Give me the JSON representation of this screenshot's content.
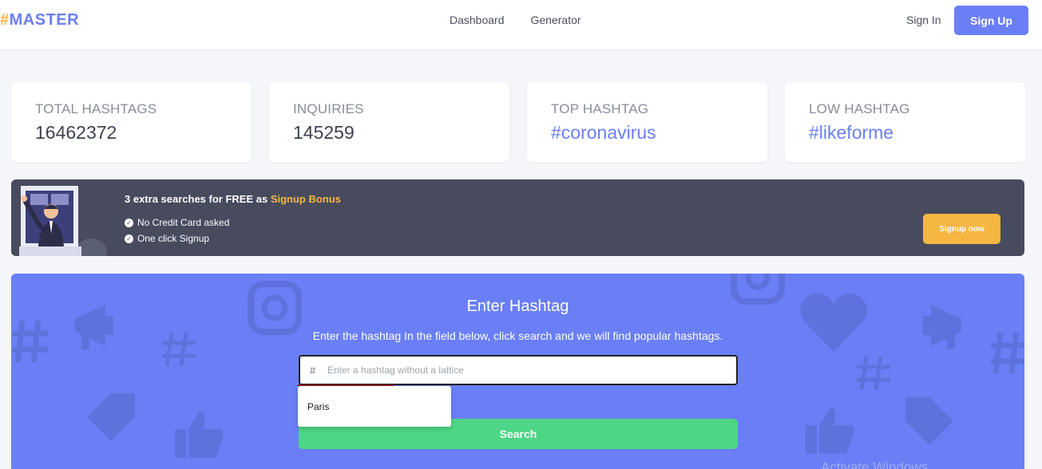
{
  "header": {
    "logo_hash": "#",
    "logo_text": "MASTER",
    "nav": [
      "Dashboard",
      "Generator"
    ],
    "sign_in": "Sign In",
    "sign_up": "Sign Up"
  },
  "stats": [
    {
      "label": "TOTAL HASHTAGS",
      "value": "16462372"
    },
    {
      "label": "INQUIRIES",
      "value": "145259"
    },
    {
      "label": "TOP HASHTAG",
      "value": "#coronavirus"
    },
    {
      "label": "LOW HASHTAG",
      "value": "#likeforme"
    }
  ],
  "banner": {
    "title_main": "3 extra searches for FREE as ",
    "title_accent": "Signup Bonus",
    "items": [
      "No Credit Card asked",
      "One click Signup"
    ],
    "button": "Signup now"
  },
  "search": {
    "title": "Enter Hashtag",
    "subtitle": "Enter the hashtag In the field below, click search and we will find popular hashtags.",
    "hash_prefix": "#",
    "placeholder": "Enter a hashtag without a lattice",
    "button": "Search",
    "suggestions": [
      "Paris"
    ]
  },
  "watermark": "Activate Windows",
  "colors": {
    "brand": "#6a7ff5",
    "accent": "#f5b642",
    "banner_bg": "#474b5d",
    "search_button": "#4cd685"
  }
}
